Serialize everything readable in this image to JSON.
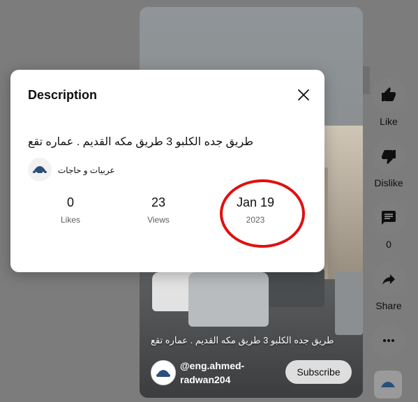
{
  "video": {
    "overlay_title": "طريق جده الكلبو 3 طريق مكه القديم . عماره تقع",
    "channel_handle": "@eng.ahmed-radwan204",
    "subscribe_label": "Subscribe"
  },
  "actions": {
    "like_label": "Like",
    "dislike_label": "Dislike",
    "comment_count": "0",
    "share_label": "Share"
  },
  "dialog": {
    "title": "Description",
    "video_title": "طريق جده الكلبو 3 طريق مكه القديم . عماره تقع",
    "channel_name": "عربيات و حاجات",
    "stats": {
      "likes_value": "0",
      "likes_label": "Likes",
      "views_value": "23",
      "views_label": "Views",
      "date_value": "Jan 19",
      "date_year": "2023"
    }
  },
  "colors": {
    "highlight": "#e01010",
    "dim_background": "#7c7c7c"
  }
}
